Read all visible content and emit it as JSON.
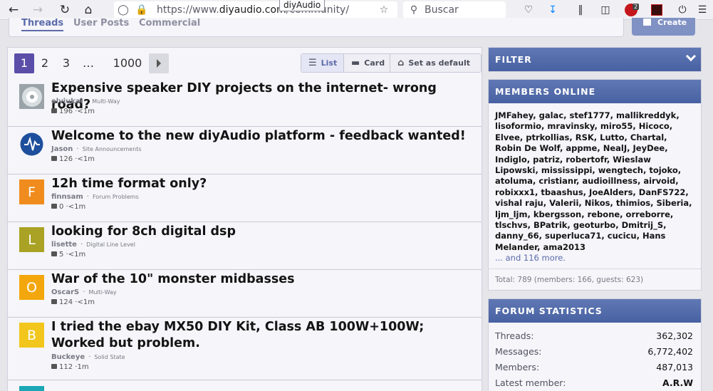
{
  "browser": {
    "url_prefix": "https://www.",
    "url_domain": "diyaudio.com",
    "url_path": "/community/",
    "tooltip": "diyAudio",
    "search_placeholder": "Buscar",
    "abp_badge": "2"
  },
  "tabs": [
    "Threads",
    "User Posts",
    "Commercial"
  ],
  "create_label": "Create",
  "pagination": {
    "pages": [
      "1",
      "2",
      "3",
      "…",
      "1000"
    ],
    "current": "1"
  },
  "view_options": {
    "list": "List",
    "card": "Card",
    "default": "Set as default"
  },
  "threads": [
    {
      "title": "Expensive speaker DIY projects on the internet- wrong road?",
      "author": "elviukai",
      "forum": "Multi-Way",
      "replies": "196",
      "time": "<1m",
      "avatar_letter": "",
      "avatar_color": "#9aa3a8"
    },
    {
      "title": "Welcome to the new diyAudio platform - feedback wanted!",
      "author": "Jason",
      "forum": "Site Announcements",
      "replies": "126",
      "time": "<1m",
      "avatar_letter": "",
      "avatar_color": "#1d4f9c"
    },
    {
      "title": "12h time format only?",
      "author": "finnsam",
      "forum": "Forum Problems",
      "replies": "0",
      "time": "<1m",
      "avatar_letter": "F",
      "avatar_color": "#f08c1e"
    },
    {
      "title": "looking for 8ch digital dsp",
      "author": "lisette",
      "forum": "Digital Line Level",
      "replies": "5",
      "time": "<1m",
      "avatar_letter": "L",
      "avatar_color": "#a9a225"
    },
    {
      "title": "War of the 10\" monster midbasses",
      "author": "OscarS",
      "forum": "Multi-Way",
      "replies": "124",
      "time": "<1m",
      "avatar_letter": "O",
      "avatar_color": "#f3a70c"
    },
    {
      "title": "I tried the ebay MX50 DIY Kit, Class AB 100W+100W; Worked but problem.",
      "author": "Buckeye",
      "forum": "Solid State",
      "replies": "112",
      "time": "1m",
      "avatar_letter": "B",
      "avatar_color": "#f2c61c"
    }
  ],
  "filter": {
    "title": "FILTER"
  },
  "members_online": {
    "title": "MEMBERS ONLINE",
    "names": "JMFahey, galac, stef1777, mallikreddyk, lisoformio, mravinsky, miro55, Hicoco, Elvee, ptrkollias, RSK, Lutto, Chartal, Robin De Wolf, appme, NealJ, JeyDee, Indiglo, patriz, robertofr, Wieslaw Lipowski, mississippi, wengtech, tojoko, atoluma, cristianr, audioillness, airvoid, robixxx1, tbaashus, JoeAlders, DanFS722, vishal raju, Valerii, Nikos, thimios, Siberia, ljm_ljm, kbergsson, rebone, orreborre, tlschvs, BPatrik, geoturbo, Dmitrij_S, danny_66, superluca71, cucicu, Hans Melander, ama2013",
    "more": "... and 116 more.",
    "total": "Total: 789 (members: 166, guests: 623)"
  },
  "forum_statistics": {
    "title": "FORUM STATISTICS",
    "rows": [
      {
        "label": "Threads:",
        "value": "362,302"
      },
      {
        "label": "Messages:",
        "value": "6,772,402"
      },
      {
        "label": "Members:",
        "value": "487,013"
      },
      {
        "label": "Latest member:",
        "value": "A.R.W"
      }
    ]
  },
  "colors": {
    "accent": "#5c6ba9",
    "header_blue": "#5069aa",
    "page_current": "#5b4ea8"
  }
}
